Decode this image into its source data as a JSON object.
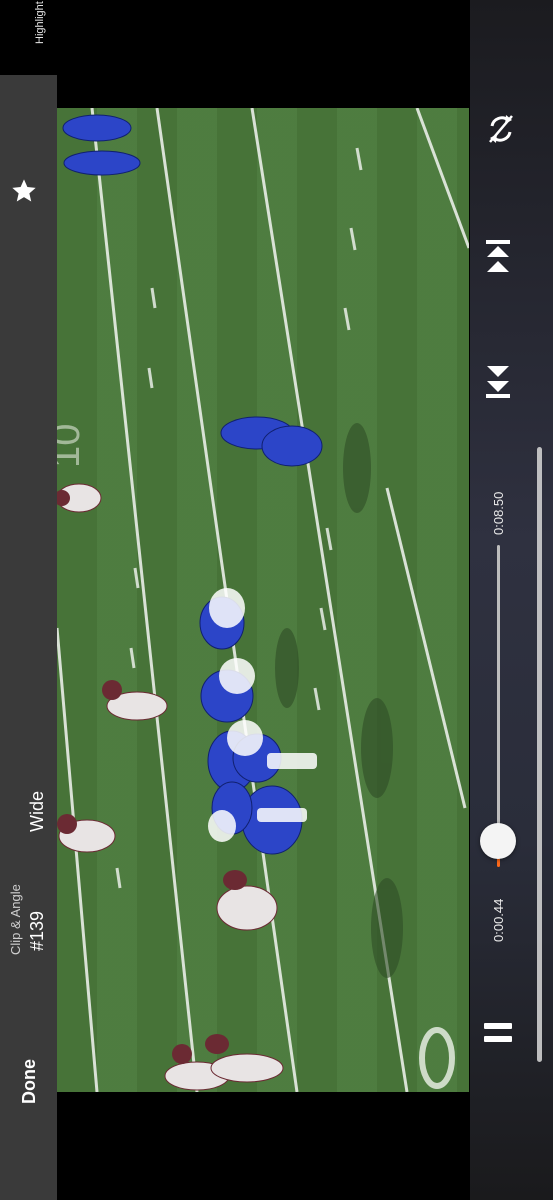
{
  "player": {
    "highlight_label": "Highlight",
    "clip_angle_label": "Clip & Angle",
    "clip_number": "#139",
    "angle": "Wide",
    "done_label": "Done"
  },
  "playback": {
    "current_time": "0:00.44",
    "end_time": "0:08.50",
    "progress": 0.05
  },
  "icons": {
    "highlight": "star-icon",
    "rotate": "rotate-icon",
    "skip_end": "skip-to-end-icon",
    "skip_start": "skip-to-start-icon",
    "pause": "pause-icon"
  },
  "colors": {
    "accent": "#ff6a1a",
    "field": "#4b7a3c",
    "home_team": "#2c45c8",
    "away_team": "#6b2a33"
  }
}
